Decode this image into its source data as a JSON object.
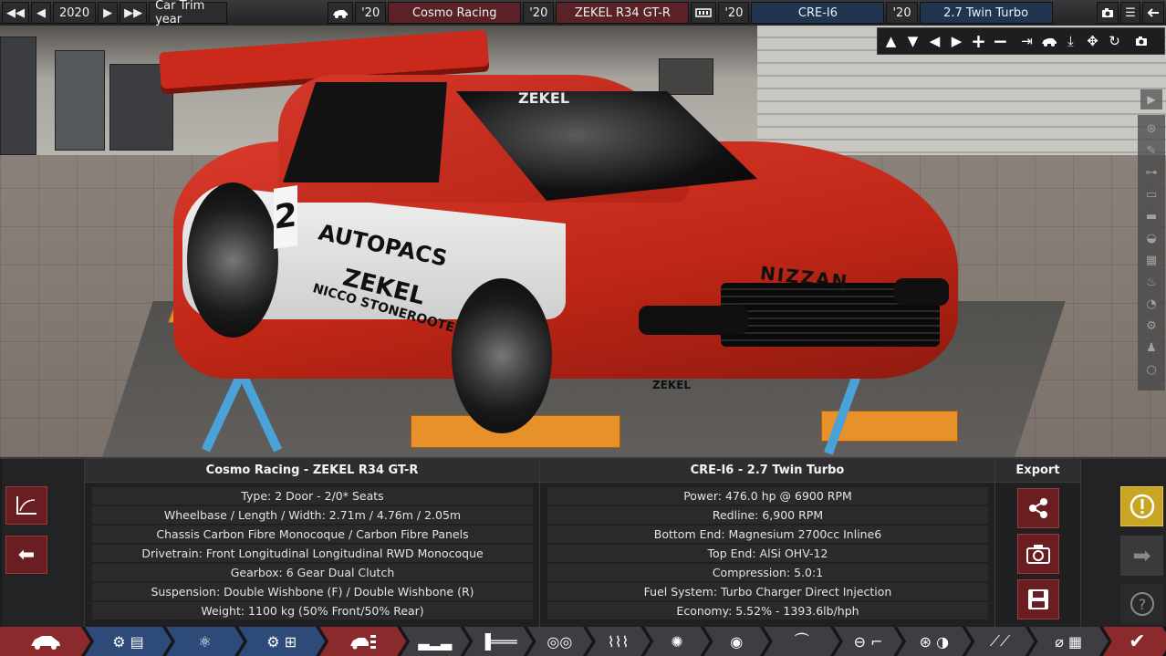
{
  "topbar": {
    "year": "2020",
    "trim_year_label": "Car Trim year",
    "model_year": "'20",
    "model_name": "Cosmo Racing",
    "trim_year": "'20",
    "trim_name": "ZEKEL R34 GT-R",
    "engine_family_year": "'20",
    "engine_family": "CRE-I6",
    "variant_year": "'20",
    "variant_name": "2.7 Twin Turbo"
  },
  "car_decals": {
    "number": "2",
    "sponsor1": "AUTOPACS",
    "sponsor2": "ZEKEL",
    "sponsor3": "NICCO STONEROOTE",
    "hood_brand": "NIZZAN",
    "bumper": "ZEKEL",
    "windshield": "ZEKEL"
  },
  "car_panel": {
    "title": "Cosmo Racing - ZEKEL R34 GT-R",
    "rows": [
      "Type: 2 Door - 2/0* Seats",
      "Wheelbase / Length / Width: 2.71m / 4.76m / 2.05m",
      "Chassis Carbon Fibre Monocoque / Carbon Fibre Panels",
      "Drivetrain: Front Longitudinal Longitudinal RWD Monocoque",
      "Gearbox: 6 Gear Dual Clutch",
      "Suspension: Double Wishbone (F) / Double Wishbone (R)",
      "Weight: 1100 kg (50% Front/50% Rear)"
    ]
  },
  "engine_panel": {
    "title": "CRE-I6 - 2.7 Twin Turbo",
    "rows": [
      "Power: 476.0 hp @ 6900 RPM",
      "Redline:  6,900 RPM",
      "Bottom End: Magnesium 2700cc Inline6",
      "Top End: AlSi OHV-12",
      "Compression: 5.0:1",
      "Fuel System: Turbo Charger Direct Injection",
      "Economy: 5.52% - 1393.6lb/hph"
    ]
  },
  "export_panel": {
    "title": "Export"
  },
  "icons": {
    "year_prev": "◀",
    "year_prev_fast": "◀◀",
    "year_next": "▶",
    "year_next_fast": "▶▶",
    "camera": "📷",
    "menu": "☰",
    "back": "⬅",
    "warning": "!",
    "next": "➡",
    "help": "?",
    "check": "✔"
  },
  "colors": {
    "accent_red": "#8a2a2c",
    "accent_blue": "#2e4a78",
    "warning_yellow": "#c9a524"
  }
}
